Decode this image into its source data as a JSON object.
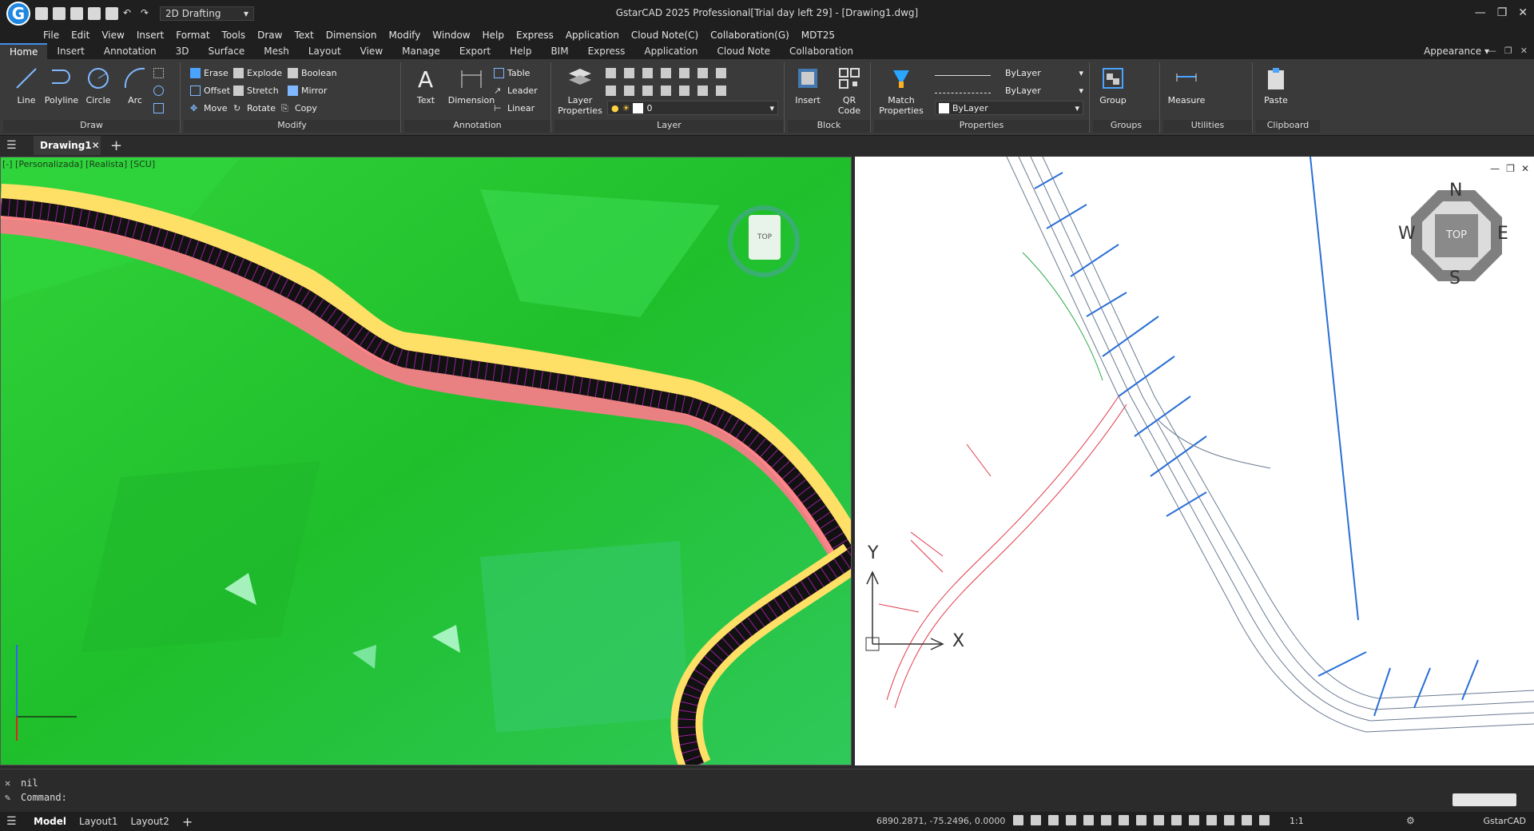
{
  "title_bar": {
    "logo_letter": "G",
    "workspace": "2D Drafting",
    "title": "GstarCAD 2025 Professional[Trial day left 29] - [Drawing1.dwg]"
  },
  "menu": [
    "File",
    "Edit",
    "View",
    "Insert",
    "Format",
    "Tools",
    "Draw",
    "Text",
    "Dimension",
    "Modify",
    "Window",
    "Help",
    "Express",
    "Application",
    "Cloud Note(C)",
    "Collaboration(G)",
    "MDT25"
  ],
  "ribbon_tabs": [
    "Home",
    "Insert",
    "Annotation",
    "3D",
    "Surface",
    "Mesh",
    "Layout",
    "View",
    "Manage",
    "Export",
    "Help",
    "BIM",
    "Express",
    "Application",
    "Cloud Note",
    "Collaboration"
  ],
  "appearance": "Appearance",
  "ribbon": {
    "draw": {
      "title": "Draw",
      "line": "Line",
      "polyline": "Polyline",
      "circle": "Circle",
      "arc": "Arc"
    },
    "modify": {
      "title": "Modify",
      "erase": "Erase",
      "explode": "Explode",
      "boolean": "Boolean",
      "offset": "Offset",
      "stretch": "Stretch",
      "mirror": "Mirror",
      "move": "Move",
      "rotate": "Rotate",
      "copy": "Copy"
    },
    "annotation": {
      "title": "Annotation",
      "text": "Text",
      "dimension": "Dimension",
      "table": "Table",
      "leader": "Leader",
      "linear": "Linear"
    },
    "layer": {
      "title": "Layer",
      "layer_properties_1": "Layer",
      "layer_properties_2": "Properties",
      "current": "0"
    },
    "block": {
      "title": "Block",
      "insert": "Insert",
      "qr_1": "QR",
      "qr_2": "Code"
    },
    "properties": {
      "title": "Properties",
      "match_1": "Match",
      "match_2": "Properties",
      "linetype": "ByLayer",
      "lineweight": "ByLayer",
      "color": "ByLayer"
    },
    "groups": {
      "title": "Groups",
      "group": "Group"
    },
    "utilities": {
      "title": "Utilities",
      "measure": "Measure"
    },
    "clipboard": {
      "title": "Clipboard",
      "paste": "Paste"
    }
  },
  "doc_tab": "Drawing1",
  "viewport_left_label": "[-] [Personalizada] [Realista] [SCU]",
  "viewcube": "TOP",
  "compass": {
    "n": "N",
    "s": "S",
    "e": "E",
    "w": "W",
    "center": "TOP"
  },
  "ucs": {
    "x": "X",
    "y": "Y"
  },
  "command": {
    "history": "nil",
    "prompt": "Command:"
  },
  "status": {
    "tabs": [
      "Model",
      "Layout1",
      "Layout2"
    ],
    "coords": "6890.2871, -75.2496, 0.0000",
    "scale": "1:1",
    "brand": "GstarCAD"
  }
}
